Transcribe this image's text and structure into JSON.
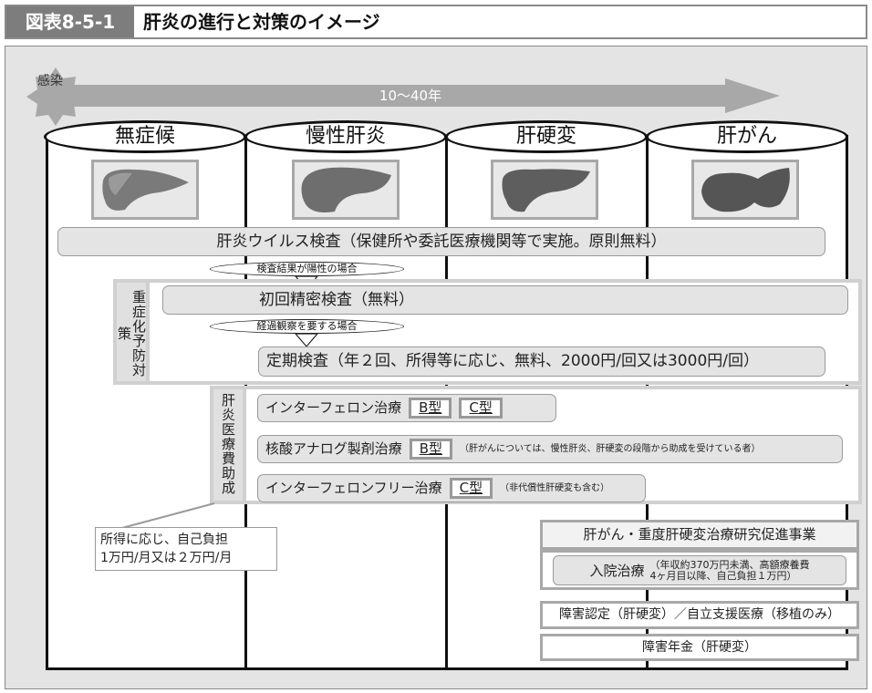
{
  "header": {
    "figure_number": "図表8-5-1",
    "title": "肝炎の進行と対策のイメージ"
  },
  "timeline": {
    "start_label": "感染",
    "duration_label": "10～40年"
  },
  "stages": [
    {
      "label": "無症候"
    },
    {
      "label": "慢性肝炎"
    },
    {
      "label": "肝硬変"
    },
    {
      "label": "肝がん"
    }
  ],
  "virus_test": "肝炎ウイルス検査（保健所や委託医療機関等で実施。原則無料）",
  "conditions": {
    "positive": "検査結果が陽性の場合",
    "observation": "経過観察を要する場合"
  },
  "prevention": {
    "side_label": "重症化予防対策",
    "first_exam": "初回精密検査（無料）",
    "regular_exam": "定期検査（年２回、所得等に応じ、無料、2000円/回又は3000円/回）"
  },
  "medical_subsidy": {
    "side_label": "肝炎医療費助成",
    "rows": [
      {
        "label": "インターフェロン治療",
        "types": [
          "B型",
          "C型"
        ],
        "note": ""
      },
      {
        "label": "核酸アナログ製剤治療",
        "types": [
          "B型"
        ],
        "note": "（肝がんについては、慢性肝炎、肝硬変の段階から助成を受けている者）"
      },
      {
        "label": "インターフェロンフリー治療",
        "types": [
          "C型"
        ],
        "note": "（非代償性肝硬変も含む）"
      }
    ]
  },
  "callout": {
    "line1": "所得に応じ、自己負担",
    "line2": "1万円/月又は２万円/月"
  },
  "late_stage": {
    "research": "肝がん・重度肝硬変治療研究促進事業",
    "hospital_label": "入院治療",
    "hospital_note_line1": "（年収約370万円未満、高額療養費",
    "hospital_note_line2": "4ヶ月目以降、自己負担１万円）",
    "disability_cert": "障害認定（肝硬変）／自立支援医療（移植のみ）",
    "disability_pension": "障害年金（肝硬変）"
  }
}
